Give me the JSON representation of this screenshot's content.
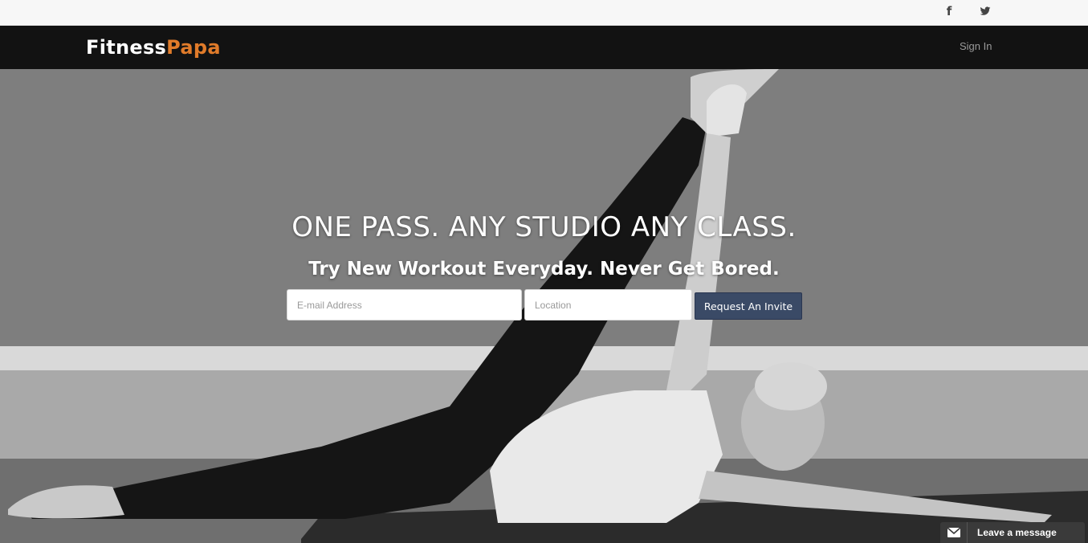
{
  "social": {
    "facebook_glyph": "f",
    "twitter_icon": "twitter-bird-icon"
  },
  "nav": {
    "brand_part1": "Fitness",
    "brand_part2": "Papa",
    "brand_accent": "#e07b2a",
    "signin": "Sign In"
  },
  "hero": {
    "headline": "ONE PASS. ANY STUDIO ANY CLASS.",
    "subline": "Try New Workout Everyday. Never Get Bored.",
    "email_placeholder": "E-mail Address",
    "location_placeholder": "Location",
    "invite_button": "Request An Invite",
    "image": "grayscale photo of woman doing yoga leg stretch on mat"
  },
  "chat": {
    "label": "Leave a message",
    "icon": "envelope-icon"
  }
}
